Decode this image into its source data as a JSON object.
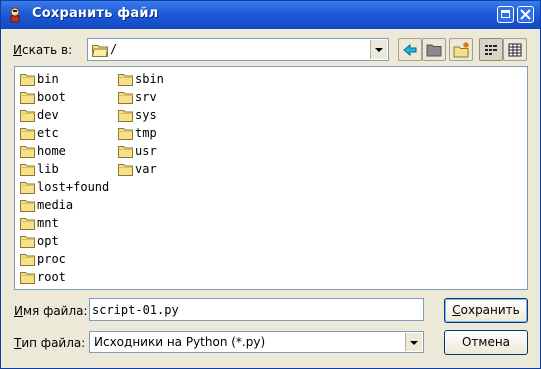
{
  "window": {
    "title": "Сохранить файл"
  },
  "lookin": {
    "label_underline": "И",
    "label_rest": "скать в:",
    "value": "/"
  },
  "files": {
    "col1": [
      "bin",
      "boot",
      "dev",
      "etc",
      "home",
      "lib",
      "lost+found",
      "media",
      "mnt",
      "opt",
      "proc",
      "root"
    ],
    "col2": [
      "sbin",
      "srv",
      "sys",
      "tmp",
      "usr",
      "var"
    ]
  },
  "filename": {
    "label_underline": "И",
    "label_rest": "мя файла:",
    "value": "script-01.py"
  },
  "filetype": {
    "label_underline": "Т",
    "label_rest": "ип файла:",
    "value": "Исходники на Python (*.py)"
  },
  "buttons": {
    "save_underline": "С",
    "save_rest": "охранить",
    "cancel": "Отмена"
  },
  "icons": [
    "back-arrow-icon",
    "parent-folder-icon",
    "new-folder-icon",
    "list-view-icon",
    "details-view-icon"
  ]
}
